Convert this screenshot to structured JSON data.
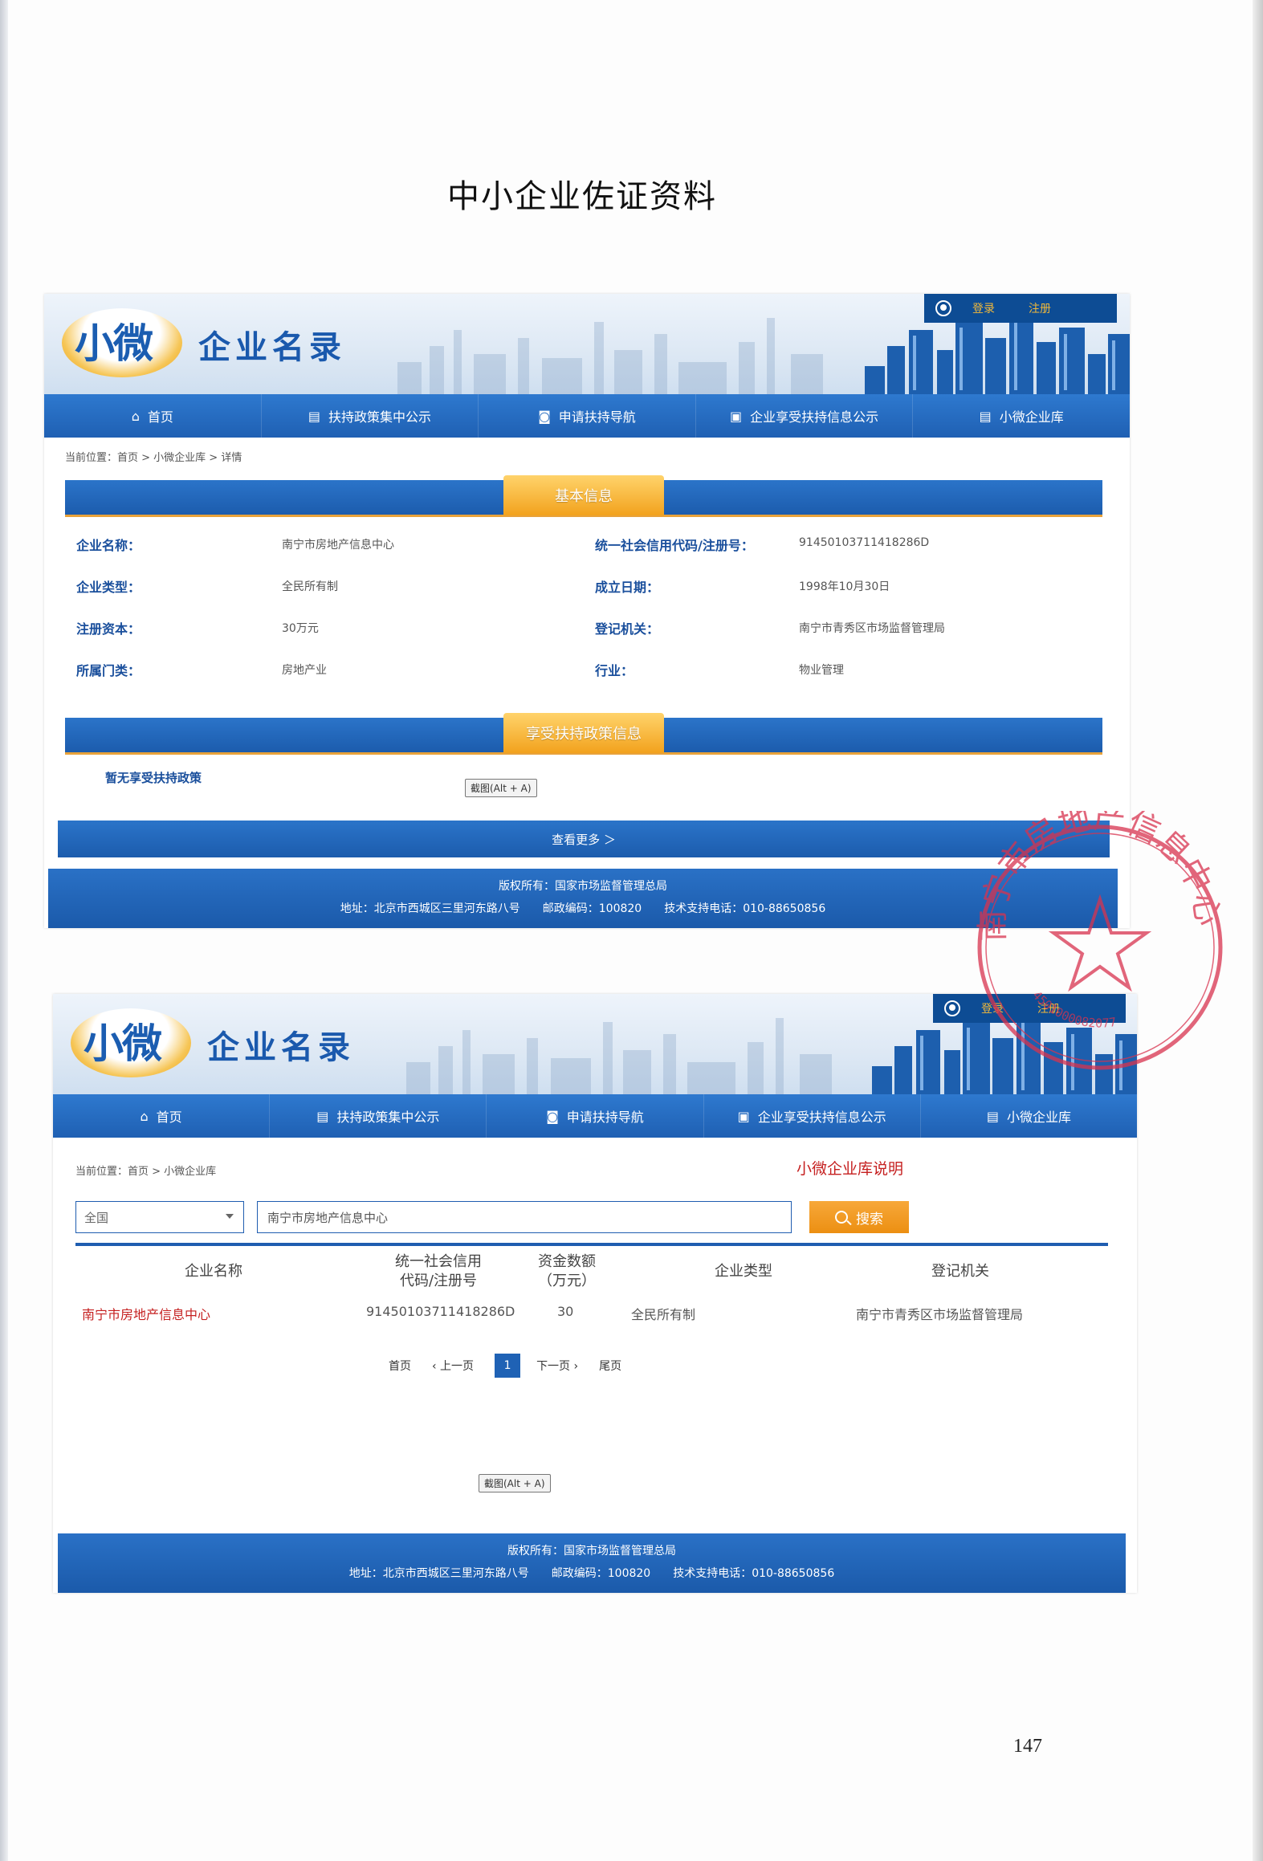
{
  "document": {
    "title": "中小企业佐证资料",
    "page_number": "147"
  },
  "site": {
    "logo_small": "小微",
    "logo_name": "企业名录",
    "login": "登录",
    "register": "注册",
    "nav": [
      {
        "icon": "home-icon",
        "glyph": "⌂",
        "label": "首页"
      },
      {
        "icon": "book-icon",
        "glyph": "▤",
        "label": "扶持政策集中公示"
      },
      {
        "icon": "navigation-icon",
        "glyph": "◙",
        "label": "申请扶持导航"
      },
      {
        "icon": "clipboard-icon",
        "glyph": "▣",
        "label": "企业享受扶持信息公示"
      },
      {
        "icon": "list-icon",
        "glyph": "▤",
        "label": "小微企业库"
      }
    ],
    "footer": {
      "copyright": "版权所有：国家市场监督管理总局",
      "address": "地址：北京市西城区三里河东路八号　　邮政编码：100820　　技术支持电话：010-88650856"
    },
    "screenshot_chip": "截图(Alt + A)"
  },
  "detail": {
    "breadcrumb": "当前位置：首页 > 小微企业库 > 详情",
    "basic_info_title": "基本信息",
    "fields": [
      {
        "label": "企业名称：",
        "value": "南宁市房地产信息中心"
      },
      {
        "label": "统一社会信用代码/注册号：",
        "value": "91450103711418286D"
      },
      {
        "label": "企业类型：",
        "value": "全民所有制"
      },
      {
        "label": "成立日期：",
        "value": "1998年10月30日"
      },
      {
        "label": "注册资本：",
        "value": "30万元"
      },
      {
        "label": "登记机关：",
        "value": "南宁市青秀区市场监督管理局"
      },
      {
        "label": "所属门类：",
        "value": "房地产业"
      },
      {
        "label": "行业：",
        "value": "物业管理"
      }
    ],
    "policy_title": "享受扶持政策信息",
    "no_policy": "暂无享受扶持政策",
    "view_more": "查看更多 ＞"
  },
  "list": {
    "breadcrumb": "当前位置：首页 > 小微企业库",
    "kb_link": "小微企业库说明",
    "region": "全国",
    "search_value": "南宁市房地产信息中心",
    "search_button": "搜索",
    "columns": [
      "企业名称",
      "统一社会信用\n代码/注册号",
      "资金数额\n（万元）",
      "企业类型",
      "登记机关"
    ],
    "row": {
      "name": "南宁市房地产信息中心",
      "code": "91450103711418286D",
      "capital": "30",
      "type": "全民所有制",
      "authority": "南宁市青秀区市场监督管理局"
    },
    "pager": {
      "first": "首页",
      "prev": "‹ 上一页",
      "current": "1",
      "next": "下一页 ›",
      "last": "尾页"
    }
  },
  "stamp": {
    "text": "南宁市房地产信息中心",
    "number": "4501000082077"
  },
  "colors": {
    "nav_blue": "#1f60b3",
    "label_blue": "#1a4f9c",
    "accent_orange": "#f2a21d",
    "link_red": "#c51f1f",
    "stamp_red": "#d8334f"
  }
}
